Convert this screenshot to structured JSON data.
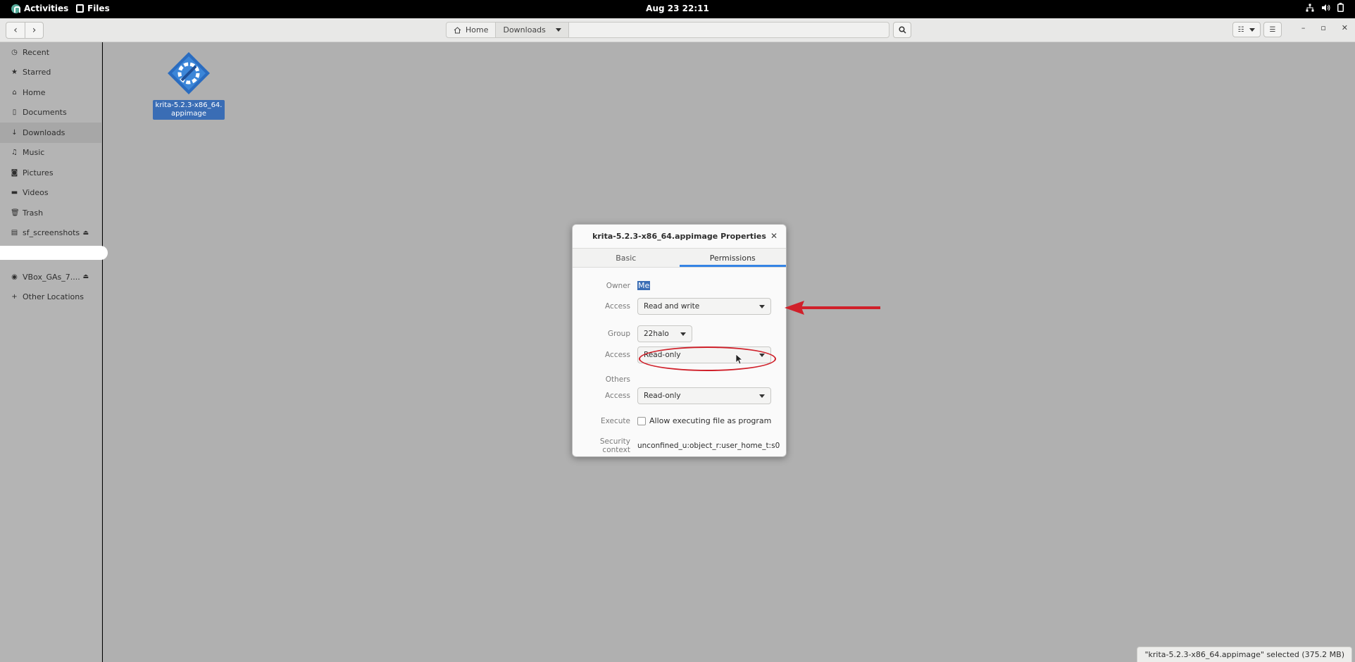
{
  "topbar": {
    "activities": "Activities",
    "app": "Files",
    "clock": "Aug 23  22:11",
    "tray_icons": [
      "network-icon",
      "volume-icon",
      "battery-icon"
    ]
  },
  "header": {
    "back": "‹",
    "forward": "›",
    "breadcrumbs": [
      "Home",
      "Downloads"
    ]
  },
  "sidebar": {
    "items": [
      {
        "label": "Recent",
        "icon": "clock-icon"
      },
      {
        "label": "Starred",
        "icon": "star-icon"
      },
      {
        "label": "Home",
        "icon": "home-icon"
      },
      {
        "label": "Documents",
        "icon": "document-icon"
      },
      {
        "label": "Downloads",
        "icon": "download-icon"
      },
      {
        "label": "Music",
        "icon": "music-icon"
      },
      {
        "label": "Pictures",
        "icon": "camera-icon"
      },
      {
        "label": "Videos",
        "icon": "video-icon"
      },
      {
        "label": "Trash",
        "icon": "trash-icon"
      },
      {
        "label": "sf_screenshots",
        "icon": "drive-icon"
      }
    ],
    "volume": {
      "label": "VBox_GAs_7....",
      "icon": "disc-icon"
    },
    "other": {
      "label": "Other Locations",
      "icon": "plus-icon"
    }
  },
  "content": {
    "file_label": "krita-5.2.3-x86_64.appimage",
    "status": "\"krita-5.2.3-x86_64.appimage\" selected (375.2 MB)"
  },
  "dialog": {
    "title": "krita-5.2.3-x86_64.appimage Properties",
    "tabs": [
      "Basic",
      "Permissions"
    ],
    "owner_label": "Owner",
    "owner_value": "Me",
    "access_label": "Access",
    "owner_access": "Read and write",
    "group_label": "Group",
    "group_value": "22halo",
    "group_access": "Read-only",
    "others_label": "Others",
    "others_access": "Read-only",
    "execute_label": "Execute",
    "execute_text": "Allow executing file as program",
    "security_label": "Security context",
    "security_value": "unconfined_u:object_r:user_home_t:s0"
  },
  "colors": {
    "selection": "#3a6db5",
    "annotation": "#d0202a",
    "accent": "#3584e4"
  }
}
